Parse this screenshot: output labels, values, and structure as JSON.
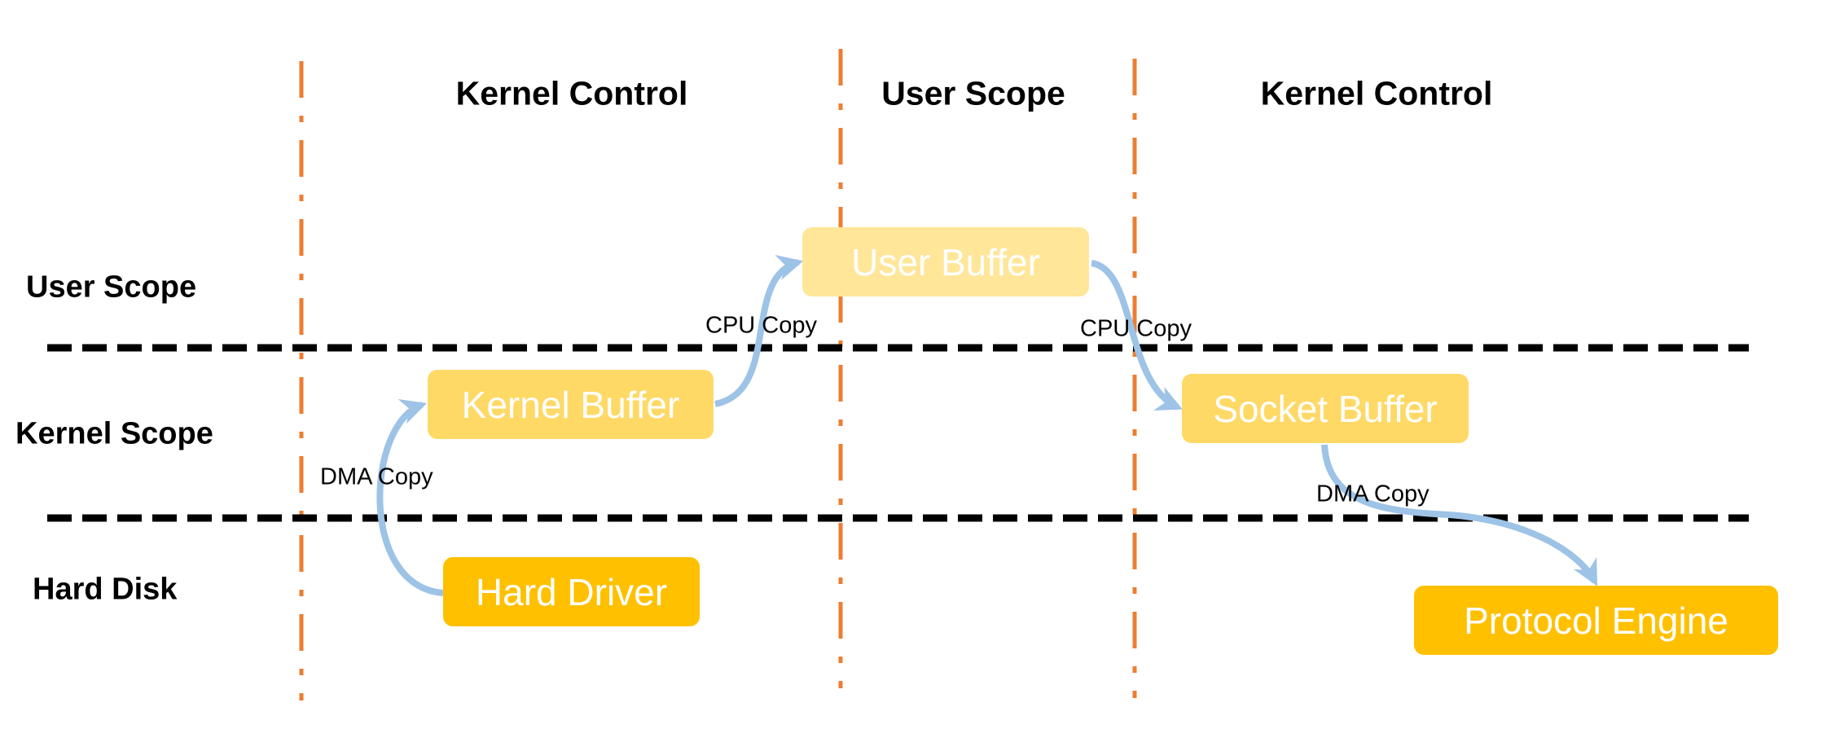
{
  "columns": [
    "Kernel Control",
    "User Scope",
    "Kernel Control"
  ],
  "rows": [
    "User Scope",
    "Kernel Scope",
    "Hard Disk"
  ],
  "boxes": {
    "user_buffer": "User Buffer",
    "kernel_buffer": "Kernel Buffer",
    "socket_buffer": "Socket Buffer",
    "hard_driver": "Hard Driver",
    "protocol_engine": "Protocol Engine"
  },
  "edges": {
    "disk_to_kernel": "DMA Copy",
    "kernel_to_user": "CPU Copy",
    "user_to_socket": "CPU Copy",
    "socket_to_protocol": "DMA Copy"
  },
  "colors": {
    "divider_vertical": "#ED7D31",
    "divider_horizontal": "#000000",
    "arrow": "#9DC3E6",
    "user_buffer": "#FFE699",
    "kernel_buffer": "#FFD966",
    "socket_buffer": "#FFD966",
    "hard_driver": "#FFC000",
    "protocol_engine": "#FFC000"
  }
}
